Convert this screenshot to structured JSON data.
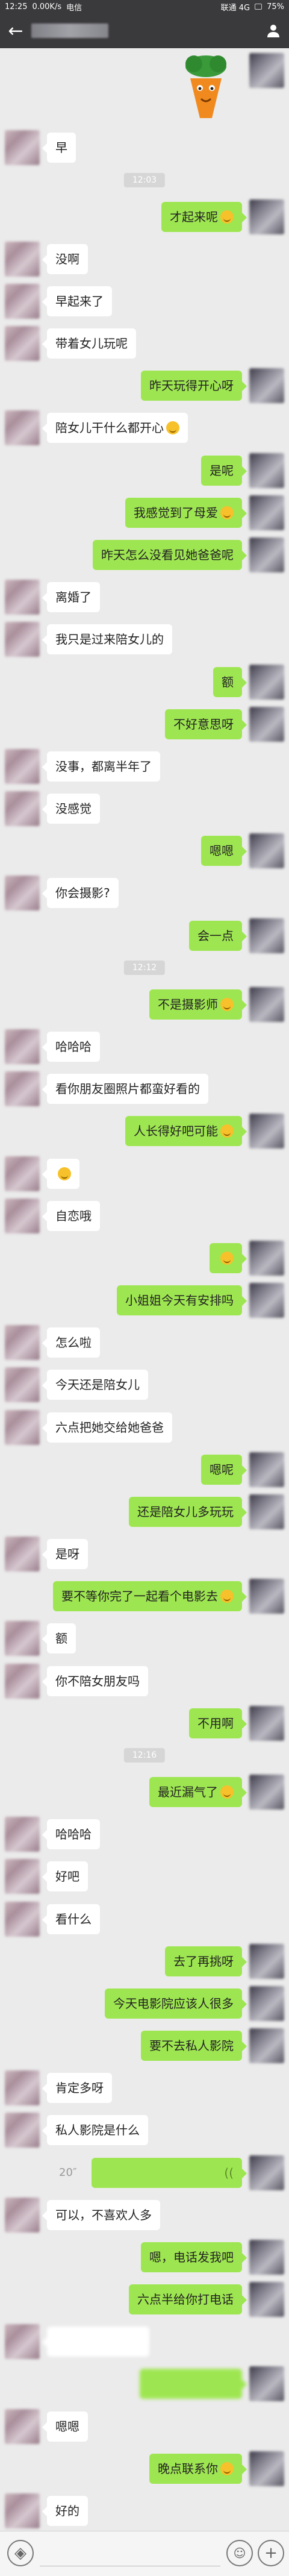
{
  "status_bar": {
    "time": "12:25",
    "speed": "0.00K/s",
    "carrier": "电信",
    "carrier2": "联通 4G",
    "battery": "75%"
  },
  "nav": {
    "back_icon": "arrow-left-icon",
    "title_redacted": true,
    "user_icon": "person-icon"
  },
  "messages": [
    {
      "kind": "sticker",
      "side": "r"
    },
    {
      "kind": "msg",
      "side": "l",
      "text": "早"
    },
    {
      "kind": "time",
      "text": "12:03"
    },
    {
      "kind": "msg",
      "side": "r",
      "text": "才起来呢",
      "emoji": true
    },
    {
      "kind": "msg",
      "side": "l",
      "text": "没啊"
    },
    {
      "kind": "msg",
      "side": "l",
      "text": "早起来了"
    },
    {
      "kind": "msg",
      "side": "l",
      "text": "带着女儿玩呢"
    },
    {
      "kind": "msg",
      "side": "r",
      "text": "昨天玩得开心呀"
    },
    {
      "kind": "msg",
      "side": "l",
      "text": "陪女儿干什么都开心",
      "emoji": true
    },
    {
      "kind": "msg",
      "side": "r",
      "text": "是呢"
    },
    {
      "kind": "msg",
      "side": "r",
      "text": "我感觉到了母爱",
      "emoji": true
    },
    {
      "kind": "msg",
      "side": "r",
      "text": "昨天怎么没看见她爸爸呢"
    },
    {
      "kind": "msg",
      "side": "l",
      "text": "离婚了"
    },
    {
      "kind": "msg",
      "side": "l",
      "text": "我只是过来陪女儿的"
    },
    {
      "kind": "msg",
      "side": "r",
      "text": "额"
    },
    {
      "kind": "msg",
      "side": "r",
      "text": "不好意思呀"
    },
    {
      "kind": "msg",
      "side": "l",
      "text": "没事，都离半年了"
    },
    {
      "kind": "msg",
      "side": "l",
      "text": "没感觉"
    },
    {
      "kind": "msg",
      "side": "r",
      "text": "嗯嗯"
    },
    {
      "kind": "msg",
      "side": "l",
      "text": "你会摄影?"
    },
    {
      "kind": "msg",
      "side": "r",
      "text": "会一点"
    },
    {
      "kind": "time",
      "text": "12:12"
    },
    {
      "kind": "msg",
      "side": "r",
      "text": "不是摄影师",
      "emoji": true
    },
    {
      "kind": "msg",
      "side": "l",
      "text": "哈哈哈"
    },
    {
      "kind": "msg",
      "side": "l",
      "text": "看你朋友圈照片都蛮好看的"
    },
    {
      "kind": "msg",
      "side": "r",
      "text": "人长得好吧可能",
      "emoji": true
    },
    {
      "kind": "msg",
      "side": "l",
      "text": "",
      "emoji": true
    },
    {
      "kind": "msg",
      "side": "l",
      "text": "自恋哦"
    },
    {
      "kind": "msg",
      "side": "r",
      "text": "",
      "emoji": true
    },
    {
      "kind": "msg",
      "side": "r",
      "text": "小姐姐今天有安排吗"
    },
    {
      "kind": "msg",
      "side": "l",
      "text": "怎么啦"
    },
    {
      "kind": "msg",
      "side": "l",
      "text": "今天还是陪女儿"
    },
    {
      "kind": "msg",
      "side": "l",
      "text": "六点把她交给她爸爸"
    },
    {
      "kind": "msg",
      "side": "r",
      "text": "嗯呢"
    },
    {
      "kind": "msg",
      "side": "r",
      "text": "还是陪女儿多玩玩"
    },
    {
      "kind": "msg",
      "side": "l",
      "text": "是呀"
    },
    {
      "kind": "msg",
      "side": "r",
      "text": "要不等你完了一起看个电影去",
      "emoji": true
    },
    {
      "kind": "msg",
      "side": "l",
      "text": "额"
    },
    {
      "kind": "msg",
      "side": "l",
      "text": "你不陪女朋友吗"
    },
    {
      "kind": "msg",
      "side": "r",
      "text": "不用啊"
    },
    {
      "kind": "time",
      "text": "12:16"
    },
    {
      "kind": "msg",
      "side": "r",
      "text": "最近漏气了",
      "emoji": true
    },
    {
      "kind": "msg",
      "side": "l",
      "text": "哈哈哈"
    },
    {
      "kind": "msg",
      "side": "l",
      "text": "好吧"
    },
    {
      "kind": "msg",
      "side": "l",
      "text": "看什么"
    },
    {
      "kind": "msg",
      "side": "r",
      "text": "去了再挑呀"
    },
    {
      "kind": "msg",
      "side": "r",
      "text": "今天电影院应该人很多"
    },
    {
      "kind": "msg",
      "side": "r",
      "text": "要不去私人影院"
    },
    {
      "kind": "msg",
      "side": "l",
      "text": "肯定多呀"
    },
    {
      "kind": "msg",
      "side": "l",
      "text": "私人影院是什么"
    },
    {
      "kind": "msg",
      "side": "r",
      "text": "20″",
      "voice": true
    },
    {
      "kind": "msg",
      "side": "l",
      "text": "可以，不喜欢人多"
    },
    {
      "kind": "msg",
      "side": "r",
      "text": "嗯，电话发我吧"
    },
    {
      "kind": "msg",
      "side": "r",
      "text": "六点半给你打电话"
    },
    {
      "kind": "msg",
      "side": "l",
      "text": "",
      "redacted": true
    },
    {
      "kind": "msg",
      "side": "r",
      "text": "",
      "redacted": true
    },
    {
      "kind": "msg",
      "side": "l",
      "text": "嗯嗯"
    },
    {
      "kind": "msg",
      "side": "r",
      "text": "晚点联系你",
      "emoji": true
    },
    {
      "kind": "msg",
      "side": "l",
      "text": "好的"
    }
  ],
  "input_bar": {
    "voice_icon": "voice-icon",
    "add_icon": "plus-icon"
  },
  "colors": {
    "bg": "#ebebeb",
    "right_bubble": "#9ee651",
    "left_bubble": "#ffffff",
    "header": "#3a3a3c"
  }
}
